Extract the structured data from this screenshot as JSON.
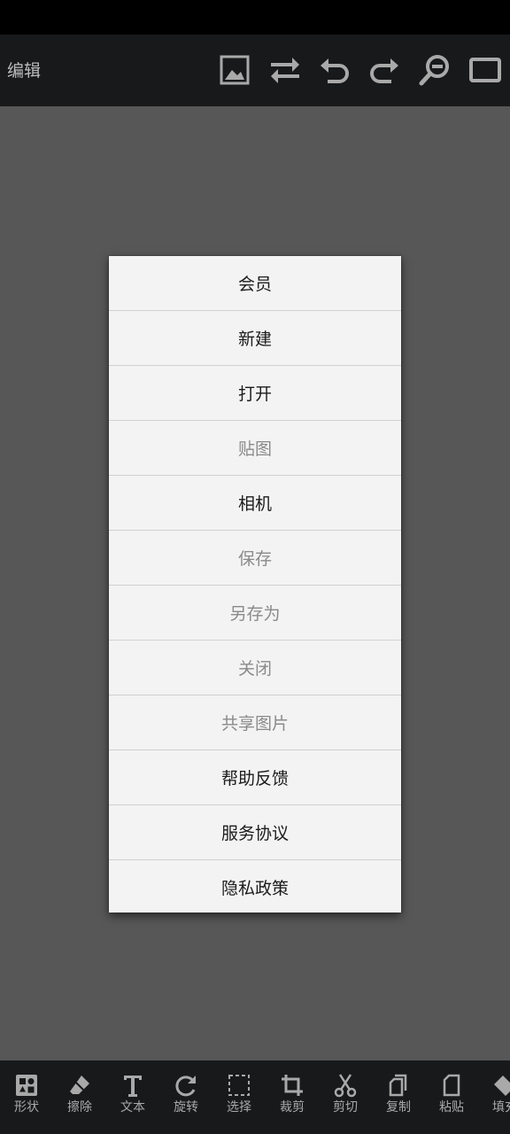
{
  "header": {
    "title": "编辑",
    "icons": [
      "image-icon",
      "swap-icon",
      "undo-icon",
      "redo-icon",
      "zoom-out-icon",
      "frame-icon"
    ]
  },
  "menu": {
    "items": [
      {
        "label": "会员",
        "enabled": true
      },
      {
        "label": "新建",
        "enabled": true
      },
      {
        "label": "打开",
        "enabled": true
      },
      {
        "label": "贴图",
        "enabled": false
      },
      {
        "label": "相机",
        "enabled": true
      },
      {
        "label": "保存",
        "enabled": false
      },
      {
        "label": "另存为",
        "enabled": false
      },
      {
        "label": "关闭",
        "enabled": false
      },
      {
        "label": "共享图片",
        "enabled": false
      },
      {
        "label": "帮助反馈",
        "enabled": true
      },
      {
        "label": "服务协议",
        "enabled": true
      },
      {
        "label": "隐私政策",
        "enabled": true
      }
    ]
  },
  "toolbar": {
    "tools": [
      {
        "label": "形状",
        "icon": "shapes-icon"
      },
      {
        "label": "擦除",
        "icon": "eraser-icon"
      },
      {
        "label": "文本",
        "icon": "text-icon"
      },
      {
        "label": "旋转",
        "icon": "rotate-icon"
      },
      {
        "label": "选择",
        "icon": "select-icon"
      },
      {
        "label": "裁剪",
        "icon": "crop-icon"
      },
      {
        "label": "剪切",
        "icon": "cut-icon"
      },
      {
        "label": "复制",
        "icon": "copy-icon"
      },
      {
        "label": "粘贴",
        "icon": "paste-icon"
      },
      {
        "label": "填充",
        "icon": "fill-icon"
      }
    ]
  },
  "colors": {
    "background": "#575757",
    "bars": "#18191b",
    "menu_bg": "#f3f3f3",
    "menu_text": "#1b1b1b",
    "menu_text_disabled": "#8a8a8a",
    "icon": "#a9a9a9"
  }
}
